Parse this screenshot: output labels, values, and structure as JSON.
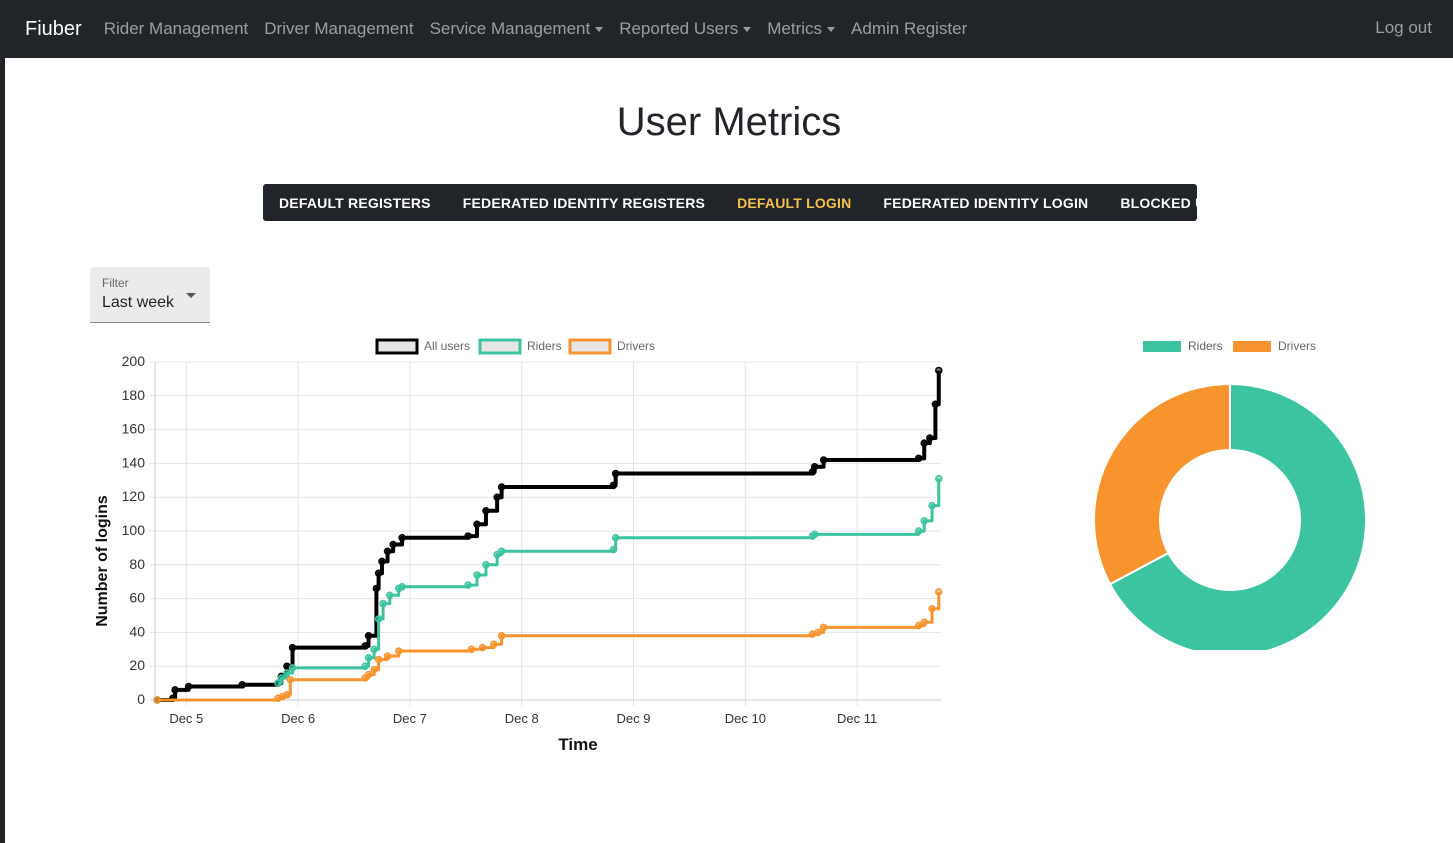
{
  "navbar": {
    "brand": "Fiuber",
    "items": [
      {
        "label": "Rider Management",
        "dropdown": false
      },
      {
        "label": "Driver Management",
        "dropdown": false
      },
      {
        "label": "Service Management",
        "dropdown": true
      },
      {
        "label": "Reported Users",
        "dropdown": true
      },
      {
        "label": "Metrics",
        "dropdown": true
      },
      {
        "label": "Admin Register",
        "dropdown": false
      }
    ],
    "logout": "Log out"
  },
  "page": {
    "title": "User Metrics"
  },
  "tabs": [
    {
      "label": "DEFAULT REGISTERS",
      "active": false
    },
    {
      "label": "FEDERATED IDENTITY REGISTERS",
      "active": false
    },
    {
      "label": "DEFAULT LOGIN",
      "active": true
    },
    {
      "label": "FEDERATED IDENTITY LOGIN",
      "active": false
    },
    {
      "label": "BLOCKED USERS",
      "active": false
    }
  ],
  "filter": {
    "label": "Filter",
    "value": "Last week"
  },
  "colors": {
    "navbar": "#212529",
    "active_tab": "#f5c24a",
    "all_users": "#000000",
    "riders": "#3cc4a0",
    "drivers": "#f7942e"
  },
  "chart_data": [
    {
      "type": "line",
      "xlabel": "Time",
      "ylabel": "Number of logins",
      "ylim": [
        0,
        200
      ],
      "yticks": [
        0,
        20,
        40,
        60,
        80,
        100,
        120,
        140,
        160,
        180,
        200
      ],
      "xticks": [
        "Dec 5",
        "Dec 6",
        "Dec 7",
        "Dec 8",
        "Dec 9",
        "Dec 10",
        "Dec 11"
      ],
      "x_range": [
        4.72,
        11.75
      ],
      "legend_position": "top",
      "grid": true,
      "series": [
        {
          "name": "All users",
          "color": "#000000",
          "points": [
            [
              4.74,
              0
            ],
            [
              4.88,
              1
            ],
            [
              4.9,
              6
            ],
            [
              5.02,
              8
            ],
            [
              5.5,
              9
            ],
            [
              5.82,
              10
            ],
            [
              5.85,
              14
            ],
            [
              5.9,
              20
            ],
            [
              5.95,
              31
            ],
            [
              6.6,
              32
            ],
            [
              6.63,
              38
            ],
            [
              6.7,
              66
            ],
            [
              6.72,
              75
            ],
            [
              6.75,
              82
            ],
            [
              6.8,
              88
            ],
            [
              6.85,
              92
            ],
            [
              6.93,
              96
            ],
            [
              7.52,
              97
            ],
            [
              7.6,
              104
            ],
            [
              7.68,
              112
            ],
            [
              7.78,
              120
            ],
            [
              7.82,
              126
            ],
            [
              8.82,
              127
            ],
            [
              8.84,
              134
            ],
            [
              10.6,
              135
            ],
            [
              10.62,
              138
            ],
            [
              10.7,
              142
            ],
            [
              11.55,
              143
            ],
            [
              11.6,
              152
            ],
            [
              11.65,
              155
            ],
            [
              11.7,
              175
            ],
            [
              11.73,
              195
            ]
          ]
        },
        {
          "name": "Riders",
          "color": "#3cc4a0",
          "points": [
            [
              5.82,
              10
            ],
            [
              5.85,
              13
            ],
            [
              5.9,
              16
            ],
            [
              5.95,
              19
            ],
            [
              6.6,
              20
            ],
            [
              6.63,
              25
            ],
            [
              6.68,
              30
            ],
            [
              6.72,
              48
            ],
            [
              6.76,
              57
            ],
            [
              6.82,
              62
            ],
            [
              6.9,
              66
            ],
            [
              6.93,
              67
            ],
            [
              7.52,
              68
            ],
            [
              7.6,
              74
            ],
            [
              7.68,
              80
            ],
            [
              7.78,
              86
            ],
            [
              7.82,
              88
            ],
            [
              8.82,
              89
            ],
            [
              8.84,
              96
            ],
            [
              10.6,
              97
            ],
            [
              10.62,
              98
            ],
            [
              11.55,
              100
            ],
            [
              11.6,
              106
            ],
            [
              11.67,
              115
            ],
            [
              11.73,
              131
            ]
          ]
        },
        {
          "name": "Drivers",
          "color": "#f7942e",
          "points": [
            [
              4.74,
              0
            ],
            [
              5.82,
              1
            ],
            [
              5.86,
              2
            ],
            [
              5.9,
              3
            ],
            [
              5.93,
              12
            ],
            [
              6.6,
              13
            ],
            [
              6.63,
              15
            ],
            [
              6.68,
              18
            ],
            [
              6.72,
              24
            ],
            [
              6.8,
              26
            ],
            [
              6.9,
              29
            ],
            [
              7.55,
              30
            ],
            [
              7.65,
              31
            ],
            [
              7.75,
              33
            ],
            [
              7.82,
              38
            ],
            [
              10.6,
              39
            ],
            [
              10.65,
              40
            ],
            [
              10.7,
              43
            ],
            [
              11.55,
              44
            ],
            [
              11.6,
              46
            ],
            [
              11.67,
              54
            ],
            [
              11.73,
              64
            ]
          ]
        }
      ]
    },
    {
      "type": "pie",
      "variant": "doughnut",
      "legend_position": "top",
      "labels": [
        "Riders",
        "Drivers"
      ],
      "values": [
        131,
        64
      ],
      "colors": [
        "#3cc4a0",
        "#f7942e"
      ]
    }
  ]
}
